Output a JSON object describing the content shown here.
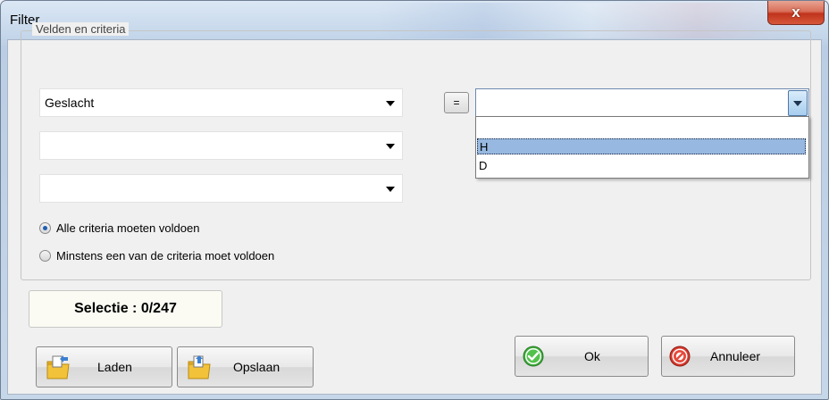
{
  "window": {
    "title": "Filter",
    "close_glyph": "x"
  },
  "group": {
    "legend": "Velden en criteria",
    "fields": [
      {
        "value": "Geslacht"
      },
      {
        "value": ""
      },
      {
        "value": ""
      }
    ],
    "operator": "=",
    "value_combo": {
      "value": "",
      "options": [
        "",
        "H",
        "D"
      ],
      "selected": "H"
    }
  },
  "match": {
    "options": [
      {
        "label": "Alle criteria moeten voldoen",
        "checked": true
      },
      {
        "label": "Minstens een van de criteria moet voldoen",
        "checked": false
      }
    ]
  },
  "selection": {
    "text": "Selectie : 0/247"
  },
  "buttons": {
    "load": "Laden",
    "save": "Opslaan",
    "ok": "Ok",
    "cancel": "Annuleer"
  },
  "icons": {
    "close": "close-icon",
    "ok": "check-circle-icon",
    "cancel": "cancel-circle-icon",
    "load": "folder-load-icon",
    "save": "folder-save-icon"
  }
}
